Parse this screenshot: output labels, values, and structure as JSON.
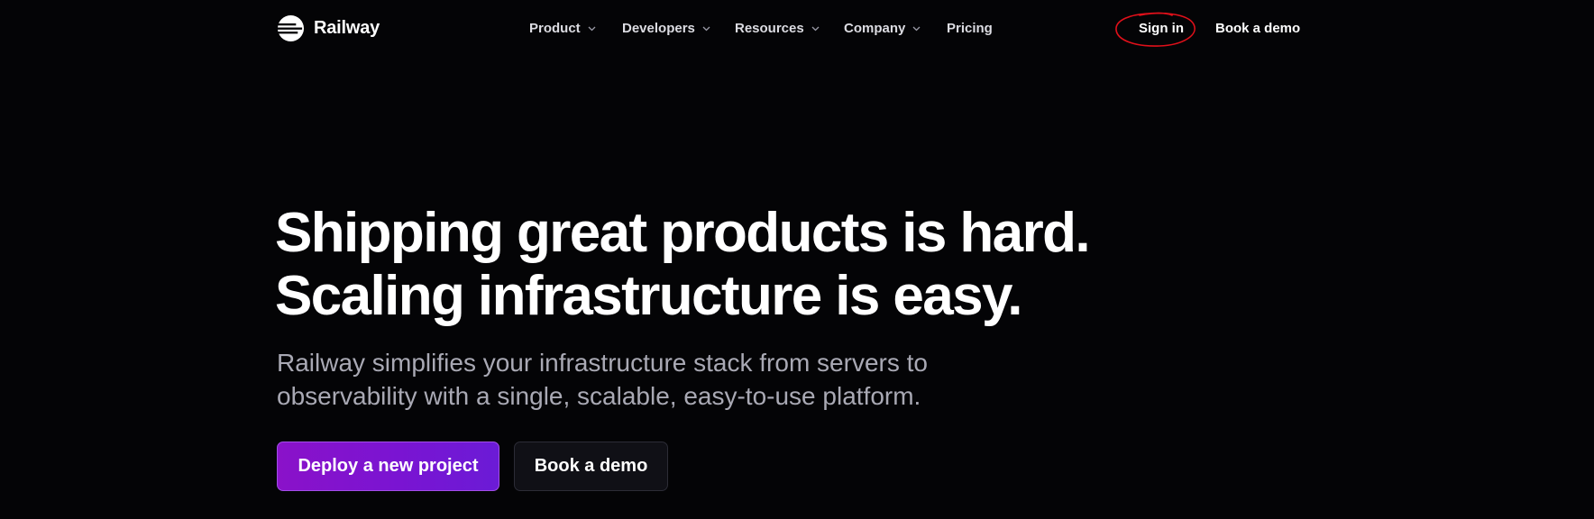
{
  "brand": {
    "name": "Railway",
    "logo_icon": "railway-logo-icon"
  },
  "nav": {
    "items": [
      {
        "label": "Product",
        "has_dropdown": true
      },
      {
        "label": "Developers",
        "has_dropdown": true
      },
      {
        "label": "Resources",
        "has_dropdown": true
      },
      {
        "label": "Company",
        "has_dropdown": true
      },
      {
        "label": "Pricing",
        "has_dropdown": false
      }
    ],
    "sign_in": "Sign in",
    "book_demo": "Book a demo"
  },
  "hero": {
    "title_line_1": "Shipping great products is hard.",
    "title_line_2": "Scaling infrastructure is easy.",
    "subtitle_line_1": "Railway simplifies your infrastructure stack from servers to",
    "subtitle_line_2": "observability with a single, scalable, easy-to-use platform.",
    "primary_cta": "Deploy a new project",
    "secondary_cta": "Book a demo"
  },
  "colors": {
    "background": "#040406",
    "primary_gradient_start": "#8a12c9",
    "primary_gradient_end": "#6b1bd6",
    "annotation": "#e0101a"
  }
}
